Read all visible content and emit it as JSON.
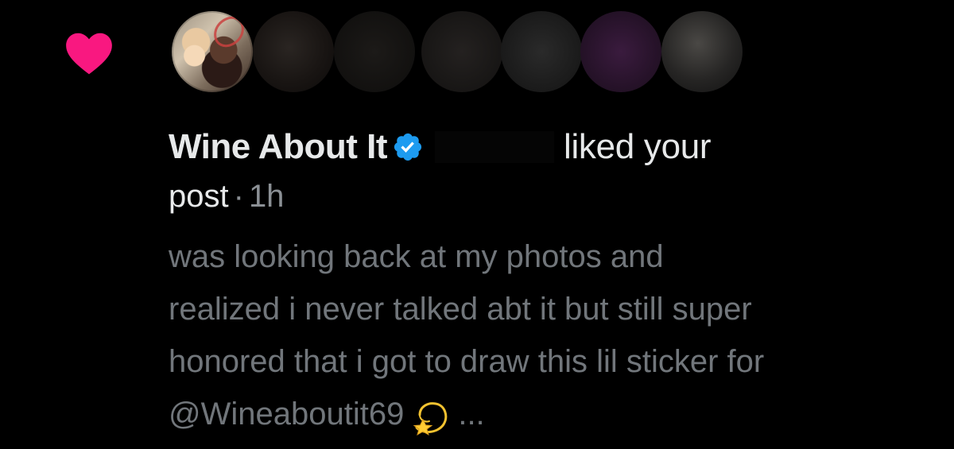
{
  "notification": {
    "icon": "heart-icon",
    "accent_color": "#f91880",
    "user_name": "Wine About It",
    "verified_color": "#1d9bf0",
    "action_text": "liked your",
    "action_text_2": "post",
    "separator": "·",
    "time": "1h",
    "post_lines": [
      "was looking back at my photos and",
      "realized i never talked abt it but still super",
      "honored that i got to draw this lil sticker for"
    ],
    "post_last_line": "@Wineaboutit69",
    "post_emoji": "dizzy-star-icon",
    "ellipsis": "..."
  }
}
